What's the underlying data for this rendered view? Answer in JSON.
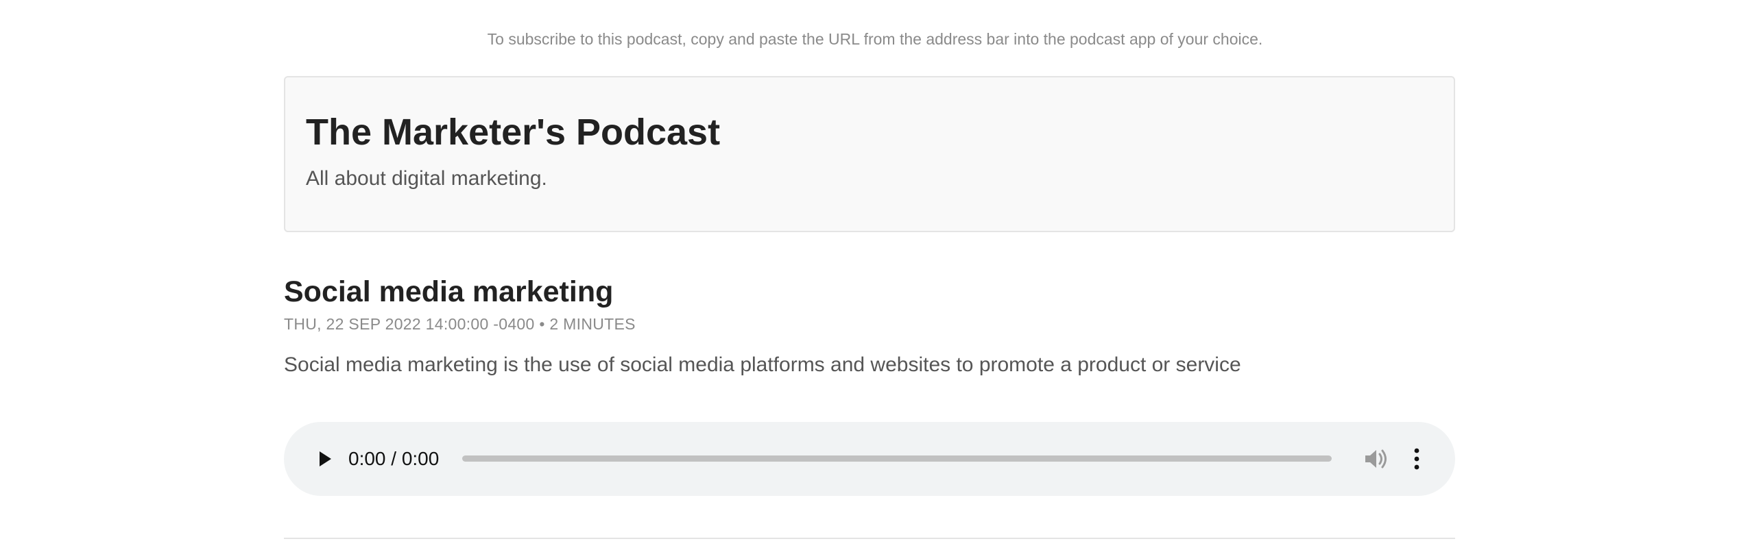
{
  "subscribe_note": "To subscribe to this podcast, copy and paste the URL from the address bar into the podcast app of your choice.",
  "podcast": {
    "title": "The Marketer's Podcast",
    "description": "All about digital marketing."
  },
  "episode": {
    "title": "Social media marketing",
    "date": "THU, 22 SEP 2022 14:00:00 -0400",
    "separator": "•",
    "duration": "2 MINUTES",
    "description": "Social media marketing is the use of social media platforms and websites to promote a product or service"
  },
  "player": {
    "time": "0:00 / 0:00",
    "progress": 0,
    "icons": {
      "play": "play-icon",
      "volume": "volume-icon",
      "more": "more-vertical-icon"
    }
  },
  "colors": {
    "player_background": "#f1f3f4",
    "header_background": "#f9f9f9",
    "muted_text": "#8a8a8a",
    "body_text": "#555555",
    "heading_text": "#222222"
  }
}
